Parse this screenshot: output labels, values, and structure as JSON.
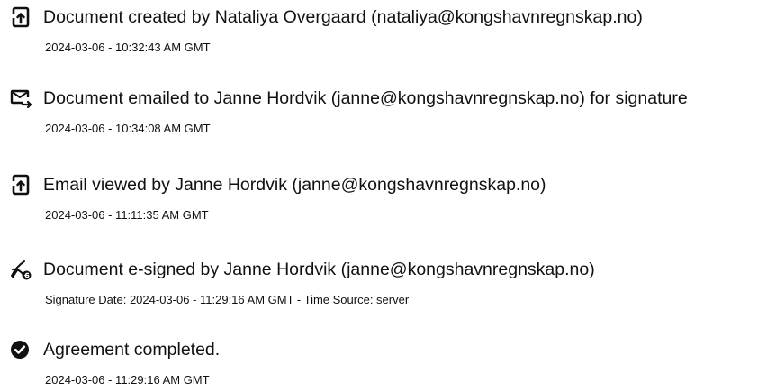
{
  "events": [
    {
      "icon": "document-upload-icon",
      "title": "Document created by Nataliya Overgaard (nataliya@kongshavnregnskap.no)",
      "subtitle": "2024-03-06 - 10:32:43 AM GMT"
    },
    {
      "icon": "email-send-icon",
      "title": "Document emailed to Janne Hordvik (janne@kongshavnregnskap.no) for signature",
      "subtitle": "2024-03-06 - 10:34:08 AM GMT"
    },
    {
      "icon": "document-view-icon",
      "title": "Email viewed by Janne Hordvik (janne@kongshavnregnskap.no)",
      "subtitle": "2024-03-06 - 11:11:35 AM GMT"
    },
    {
      "icon": "e-sign-pen-icon",
      "title": "Document e-signed by Janne Hordvik (janne@kongshavnregnskap.no)",
      "subtitle": "Signature Date: 2024-03-06 - 11:29:16 AM GMT - Time Source: server"
    },
    {
      "icon": "check-circle-icon",
      "title": "Agreement completed.",
      "subtitle": "2024-03-06 - 11:29:16 AM GMT"
    }
  ]
}
